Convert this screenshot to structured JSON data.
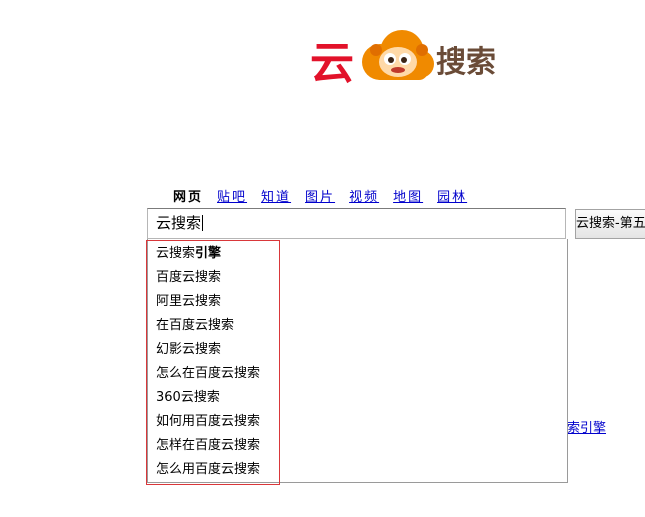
{
  "logo": {
    "char_left": "云",
    "char_right": "搜索",
    "brand_red": "#e2122a",
    "brand_orange": "#f08a00",
    "brand_brown": "#6a4b37",
    "mascot_icon": "monkey-cloud-icon"
  },
  "nav": {
    "tabs": [
      {
        "label": "网页",
        "active": true
      },
      {
        "label": "贴吧",
        "active": false
      },
      {
        "label": "知道",
        "active": false
      },
      {
        "label": "图片",
        "active": false
      },
      {
        "label": "视频",
        "active": false
      },
      {
        "label": "地图",
        "active": false
      },
      {
        "label": "园林",
        "active": false
      }
    ]
  },
  "search": {
    "value": "云搜索",
    "button_label": "云搜索-第五"
  },
  "suggestions": [
    {
      "prefix": "云搜索",
      "rest": "引擎"
    },
    {
      "prefix": "百度云搜索",
      "rest": ""
    },
    {
      "prefix": "阿里云搜索",
      "rest": ""
    },
    {
      "prefix": "在百度云搜索",
      "rest": ""
    },
    {
      "prefix": "幻影云搜索",
      "rest": ""
    },
    {
      "prefix": "怎么在百度云搜索",
      "rest": ""
    },
    {
      "prefix": "360云搜索",
      "rest": ""
    },
    {
      "prefix": "如何用百度云搜索",
      "rest": ""
    },
    {
      "prefix": "怎样在百度云搜索",
      "rest": ""
    },
    {
      "prefix": "怎么用百度云搜索",
      "rest": ""
    }
  ],
  "background_link": "搜索引擎",
  "highlight_color": "#d9373a"
}
